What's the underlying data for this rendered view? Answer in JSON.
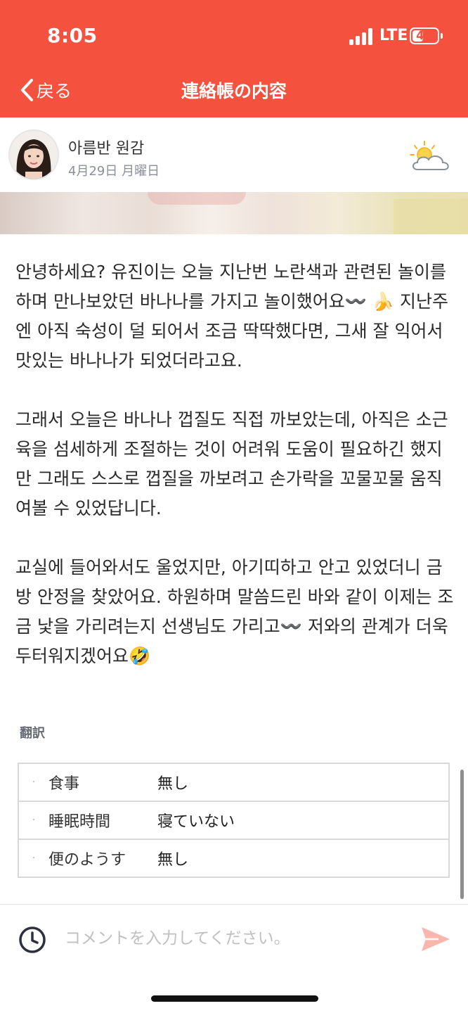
{
  "status_bar": {
    "time": "8:05",
    "network": "LTE",
    "battery": "45",
    "battery_level": 0.45
  },
  "nav": {
    "back_label": "戻る",
    "title": "連絡帳の内容"
  },
  "author": {
    "name": "아름반 원감",
    "date": "4月29日 月曜日",
    "weather_icon": "sun-behind-cloud-icon"
  },
  "content": {
    "paragraphs": [
      "안녕하세요? 유진이는 오늘 지난번 노란색과 관련된 놀이를 하며 만나보았던 바나나를 가지고 놀이했어요〰️ 🍌 지난주엔 아직 숙성이 덜 되어서 조금 딱딱했다면, 그새 잘 익어서 맛있는 바나나가 되었더라고요.",
      " 그래서 오늘은 바나나 껍질도 직접 까보았는데, 아직은 소근육을 섬세하게 조절하는 것이 어려워 도움이 필요하긴 했지만 그래도 스스로 껍질을 까보려고 손가락을 꼬물꼬물 움직여볼 수 있었답니다.",
      " 교실에 들어와서도 울었지만, 아기띠하고 안고 있었더니 금방 안정을 찾았어요. 하원하며 말씀드린 바와 같이 이제는 조금 낯을 가리려는지 선생님도 가리고〰️ 저와의 관계가 더욱 두터워지겠어요🤣"
    ]
  },
  "translate_label": "翻訳",
  "info": {
    "rows": [
      {
        "label": "食事",
        "value": "無し"
      },
      {
        "label": "睡眠時間",
        "value": "寝ていない"
      },
      {
        "label": "便のようす",
        "value": "無し"
      }
    ]
  },
  "comment": {
    "placeholder": "コメントを入力してください。"
  },
  "colors": {
    "brand": "#f4523f",
    "send": "#f8b6ac"
  }
}
